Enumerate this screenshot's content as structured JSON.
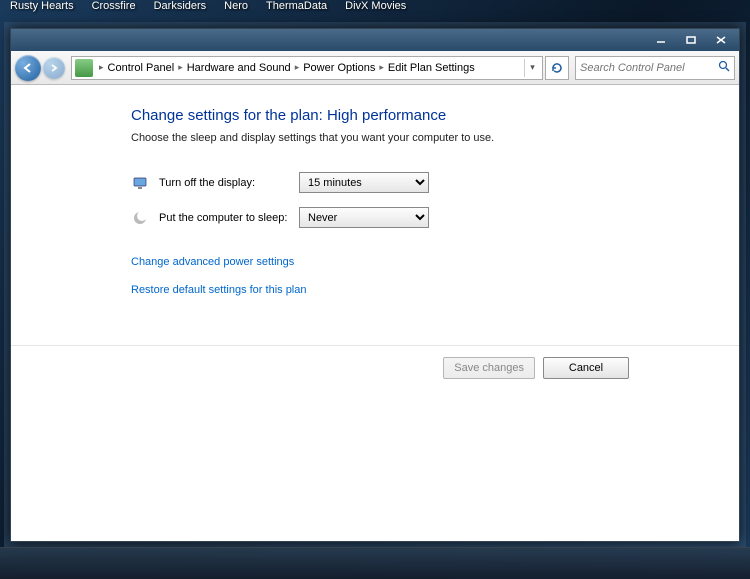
{
  "desktop": {
    "icons_row1": [
      "Rusty Hearts",
      "Crossfire",
      "Darksiders",
      "Nero",
      "ThermaData",
      "DivX Movies"
    ],
    "icons_row2": [
      "",
      "",
      "",
      ""
    ]
  },
  "window_controls": {
    "minimize": "Minimize",
    "maximize": "Maximize",
    "close": "Close"
  },
  "breadcrumb": {
    "items": [
      "Control Panel",
      "Hardware and Sound",
      "Power Options",
      "Edit Plan Settings"
    ]
  },
  "search": {
    "placeholder": "Search Control Panel"
  },
  "page": {
    "heading": "Change settings for the plan: High performance",
    "subtext": "Choose the sleep and display settings that you want your computer to use."
  },
  "settings": {
    "display": {
      "label": "Turn off the display:",
      "value": "15 minutes"
    },
    "sleep": {
      "label": "Put the computer to sleep:",
      "value": "Never"
    }
  },
  "links": {
    "advanced": "Change advanced power settings",
    "restore": "Restore default settings for this plan"
  },
  "buttons": {
    "save": "Save changes",
    "cancel": "Cancel"
  }
}
